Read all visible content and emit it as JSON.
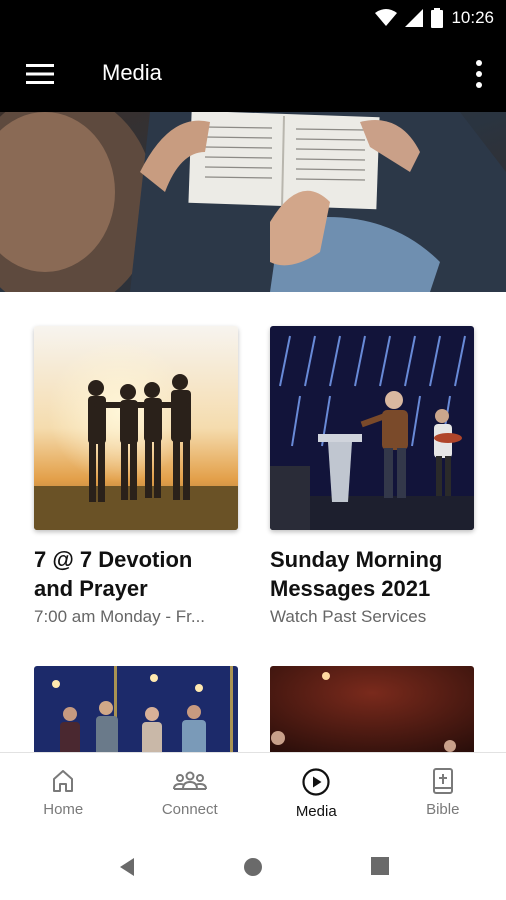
{
  "status_bar": {
    "time": "10:26"
  },
  "app_bar": {
    "title": "Media",
    "menu_icon": "hamburger-menu-icon",
    "more_icon": "more-vertical-icon"
  },
  "cards": [
    {
      "title_line1": "7 @ 7 Devotion",
      "title_line2": "and Prayer",
      "subtitle": "7:00 am Monday - Fr..."
    },
    {
      "title_line1": "Sunday Morning",
      "title_line2": "Messages 2021",
      "subtitle": "Watch Past Services"
    }
  ],
  "bottom_nav": {
    "items": [
      {
        "label": "Home",
        "icon": "home-icon"
      },
      {
        "label": "Connect",
        "icon": "group-icon"
      },
      {
        "label": "Media",
        "icon": "play-circle-icon"
      },
      {
        "label": "Bible",
        "icon": "bible-icon"
      }
    ],
    "active": "Media"
  },
  "colors": {
    "bar_bg": "#000000",
    "nav_active": "#111111",
    "nav_inactive": "#7a7a7a",
    "subtitle": "#666666"
  }
}
